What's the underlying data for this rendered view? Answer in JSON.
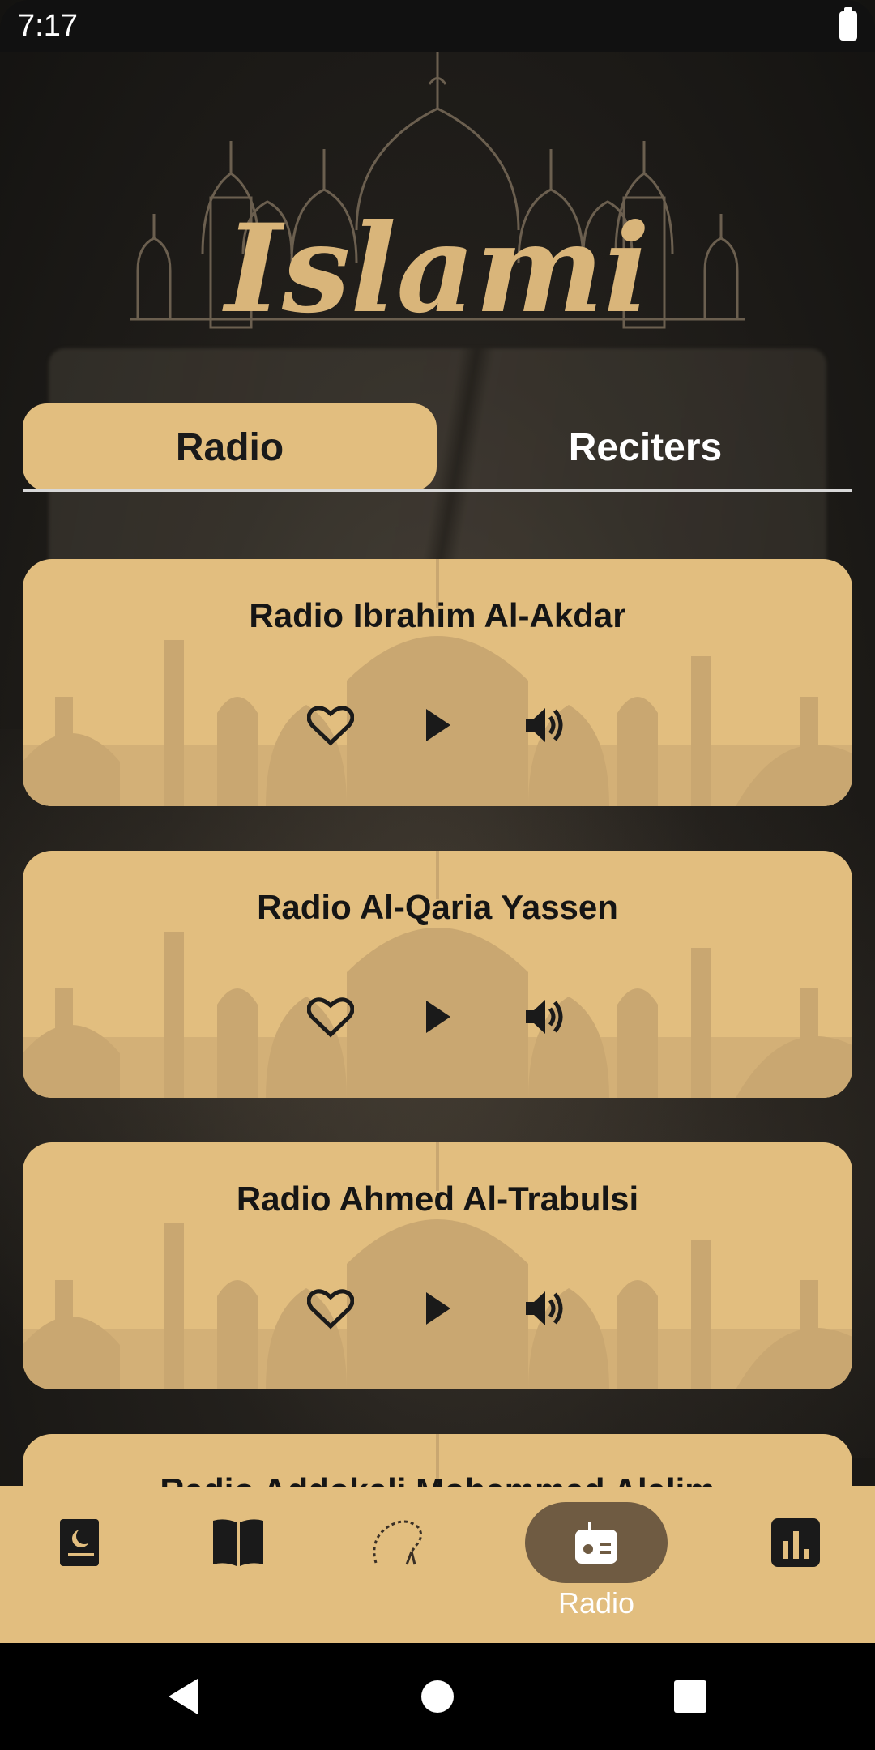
{
  "status_bar": {
    "time": "7:17"
  },
  "header": {
    "logo_text": "Islami"
  },
  "tabs": [
    {
      "label": "Radio",
      "selected": true
    },
    {
      "label": "Reciters",
      "selected": false
    }
  ],
  "radios": [
    {
      "name": "Radio Ibrahim Al-Akdar"
    },
    {
      "name": "Radio Al-Qaria Yassen"
    },
    {
      "name": "Radio Ahmed Al-Trabulsi"
    },
    {
      "name": "Radio Addokali Mohammad Alalim"
    }
  ],
  "bottom_nav": {
    "items": [
      {
        "icon": "quran-book-icon"
      },
      {
        "icon": "open-book-icon"
      },
      {
        "icon": "sebha-beads-icon"
      },
      {
        "icon": "radio-icon",
        "label": "Radio",
        "selected": true
      },
      {
        "icon": "stats-icon"
      }
    ]
  },
  "colors": {
    "gold": "#e2be7f",
    "dark": "#1a1a1a",
    "selected_pill": "#6f5b42"
  }
}
